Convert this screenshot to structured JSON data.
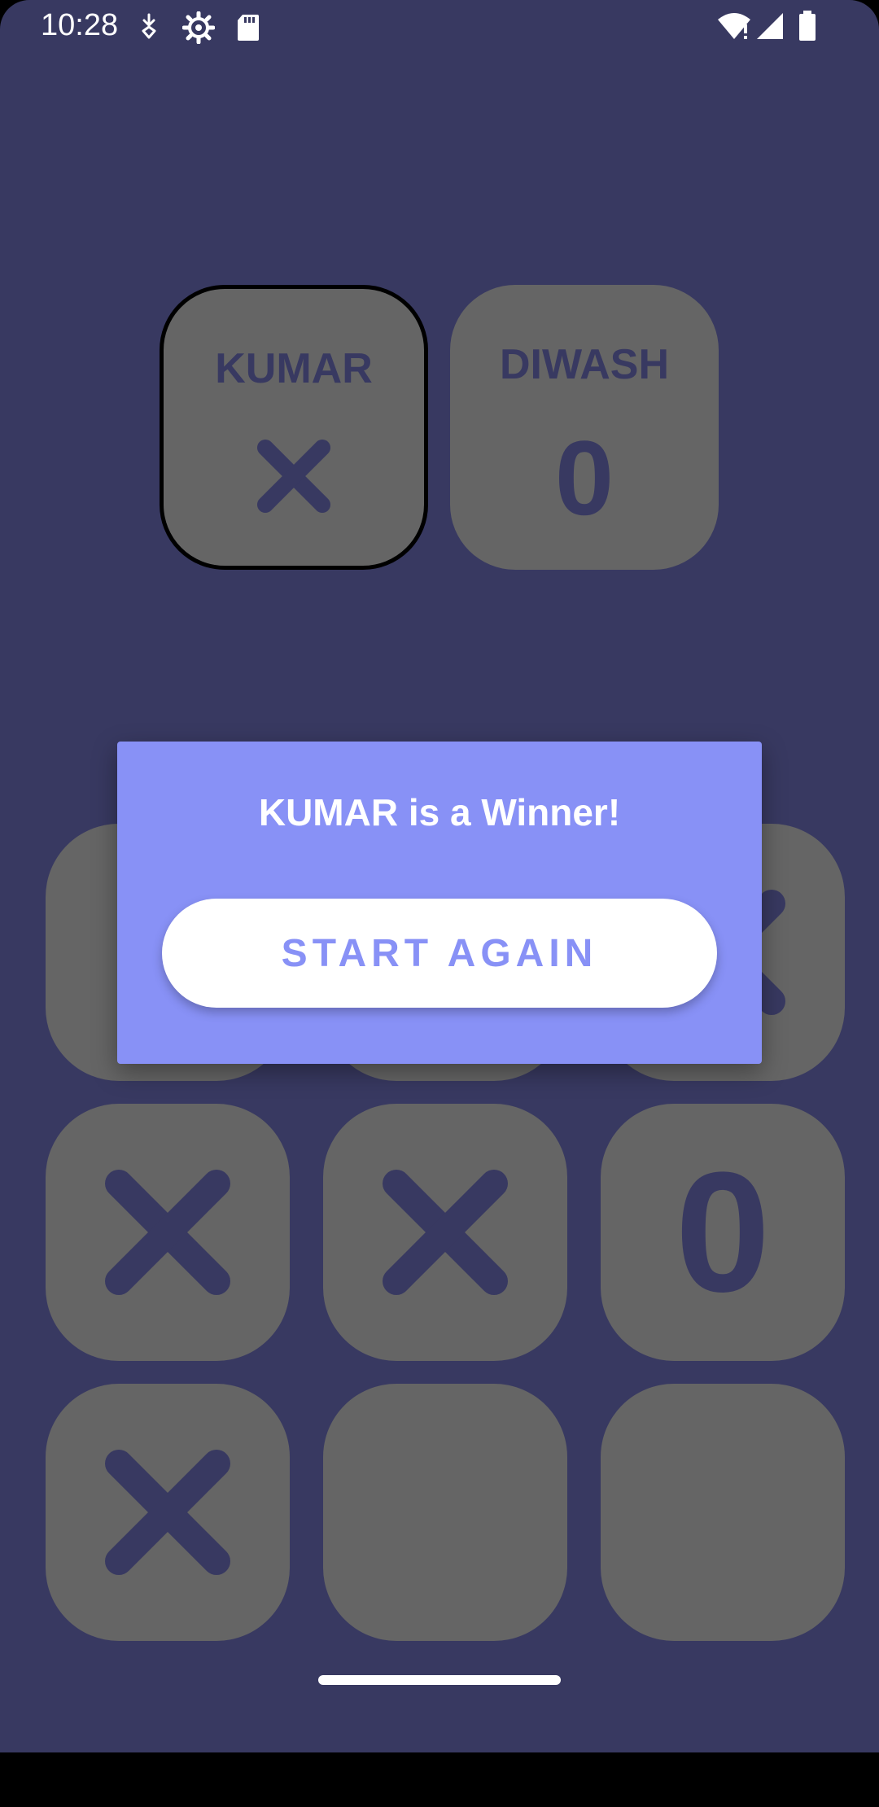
{
  "status_bar": {
    "time": "10:28",
    "left_icons": [
      "download-icon",
      "settings-gear-icon",
      "sd-card-icon"
    ],
    "right_icons": [
      "wifi-alert-icon",
      "signal-icon",
      "battery-icon"
    ]
  },
  "players": [
    {
      "name": "KUMAR",
      "symbol": "X",
      "active": true
    },
    {
      "name": "DIWASH",
      "symbol": "0",
      "active": false
    }
  ],
  "board": [
    [
      "",
      "",
      "X"
    ],
    [
      "X",
      "X",
      "0"
    ],
    [
      "X",
      "",
      ""
    ]
  ],
  "dialog": {
    "message": "KUMAR is a Winner!",
    "button_label": "START AGAIN"
  },
  "colors": {
    "background": "#383961",
    "tile": "#656565",
    "accent": "#8891f6",
    "mark": "#383961"
  }
}
